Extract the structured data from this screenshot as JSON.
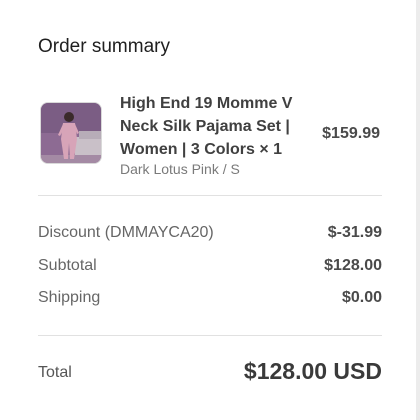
{
  "summary": {
    "title": "Order summary"
  },
  "product": {
    "image_alt": "product-photo",
    "name": "High End 19 Momme V Neck Silk Pajama Set | Women | 3 Colors × 1",
    "variant": "Dark Lotus Pink / S",
    "price": "$159.99"
  },
  "costs": {
    "discount_label": "Discount (DMMAYCA20)",
    "discount_value": "$-31.99",
    "subtotal_label": "Subtotal",
    "subtotal_value": "$128.00",
    "shipping_label": "Shipping",
    "shipping_value": "$0.00"
  },
  "total": {
    "label": "Total",
    "value": "$128.00 USD"
  },
  "colors": {
    "thumb_bg": "#8d6b93",
    "thumb_outfit": "#d7a4b8"
  }
}
